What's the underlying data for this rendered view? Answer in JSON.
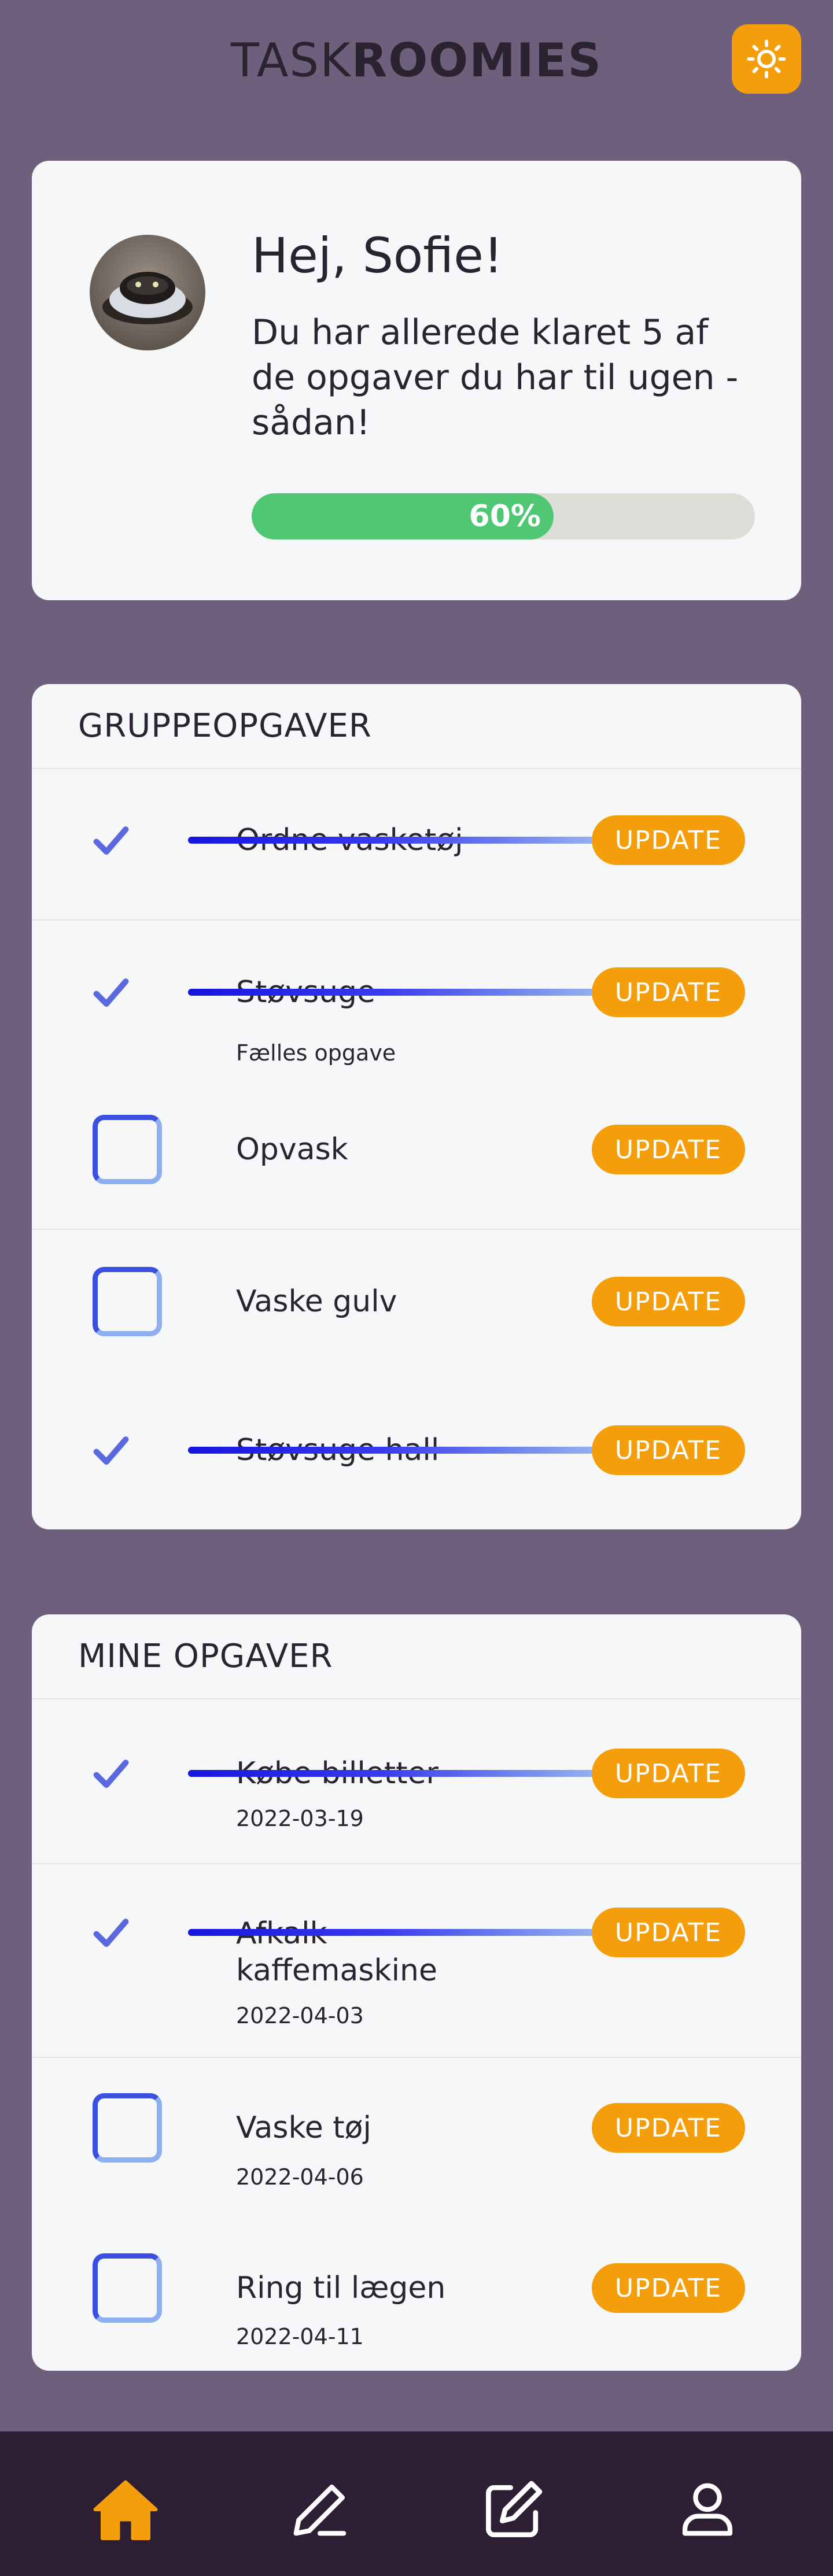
{
  "app": {
    "logo_thin": "TASK",
    "logo_bold": "ROOMIES",
    "theme_toggle_icon": "sun-icon",
    "accent_color": "#f59e0b"
  },
  "profile": {
    "greeting": "Hej, Sofie!",
    "summary": "Du har allerede klaret 5 af de opgaver du har til ugen - sådan!",
    "progress_label": "60%",
    "progress_value": 0.6,
    "avatar_icon": "profile-photo"
  },
  "group_tasks": {
    "title": "GRUPPEOPGAVER",
    "items": [
      {
        "label": "Ordne vasketøj",
        "done": true,
        "sub": "",
        "button": "UPDATE"
      },
      {
        "label": "Støvsuge",
        "done": true,
        "sub": "Fælles opgave",
        "button": "UPDATE"
      },
      {
        "label": "Opvask",
        "done": false,
        "sub": "",
        "button": "UPDATE"
      },
      {
        "label": "Vaske gulv",
        "done": false,
        "sub": "",
        "button": "UPDATE"
      },
      {
        "label": "Støvsuge hall",
        "done": true,
        "sub": "",
        "button": "UPDATE"
      }
    ]
  },
  "my_tasks": {
    "title": "MINE OPGAVER",
    "items": [
      {
        "label": "Købe billetter",
        "done": true,
        "sub": "2022-03-19",
        "button": "UPDATE"
      },
      {
        "label": "Afkalk kaffemaskine",
        "done": true,
        "sub": "2022-04-03",
        "button": "UPDATE"
      },
      {
        "label": "Vaske tøj",
        "done": false,
        "sub": "2022-04-06",
        "button": "UPDATE"
      },
      {
        "label": "Ring til lægen",
        "done": false,
        "sub": "2022-04-11",
        "button": "UPDATE"
      }
    ]
  },
  "nav": {
    "items": [
      {
        "icon": "home-icon",
        "active": true
      },
      {
        "icon": "pencil-icon",
        "active": false
      },
      {
        "icon": "edit-square-icon",
        "active": false
      },
      {
        "icon": "user-icon",
        "active": false
      }
    ]
  }
}
